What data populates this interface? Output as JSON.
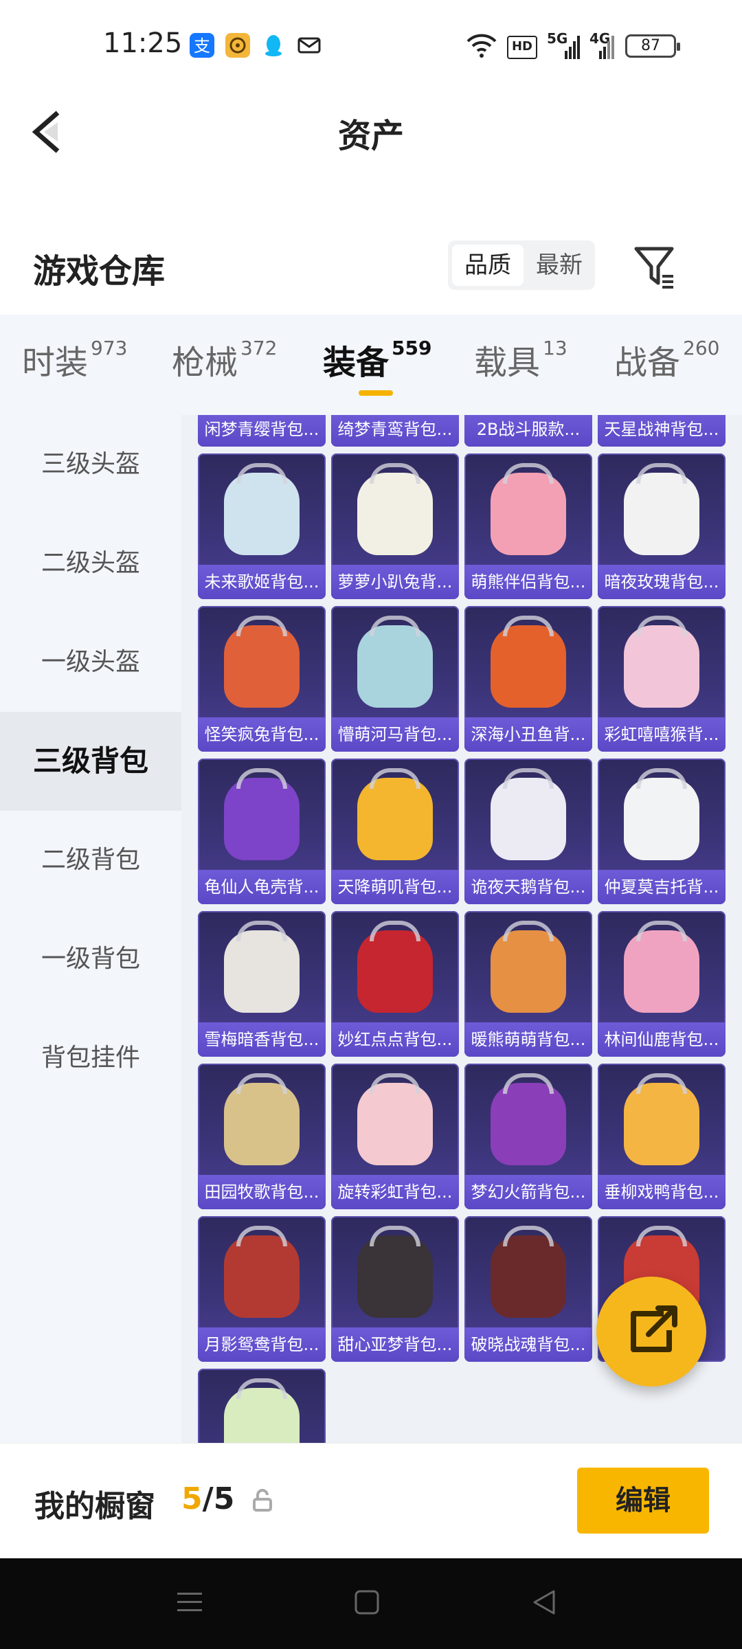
{
  "status_bar": {
    "time": "11:25",
    "network_label": "HD",
    "signal1": "5G",
    "signal2": "4G",
    "battery": "87",
    "notification_icons": [
      "alipay-icon",
      "wallet-app-icon",
      "qq-icon",
      "mail-icon"
    ],
    "right_icons": [
      "wifi-icon",
      "hd-icon",
      "signal-5g-icon",
      "signal-4g-icon",
      "battery-icon"
    ]
  },
  "header": {
    "title": "资产",
    "back_icon": "back-arrow-icon"
  },
  "section": {
    "title": "游戏仓库",
    "sort_options": [
      "品质",
      "最新"
    ],
    "sort_selected": "品质",
    "filter_icon": "filter-icon"
  },
  "tabs": [
    {
      "label": "时装",
      "count": "973"
    },
    {
      "label": "枪械",
      "count": "372"
    },
    {
      "label": "装备",
      "count": "559"
    },
    {
      "label": "载具",
      "count": "13"
    },
    {
      "label": "战备",
      "count": "260"
    }
  ],
  "active_tab": "装备",
  "sidebar": {
    "items": [
      "三级头盔",
      "二级头盔",
      "一级头盔",
      "三级背包",
      "二级背包",
      "一级背包",
      "背包挂件"
    ],
    "active": "三级背包"
  },
  "items": [
    {
      "name": "闲梦青缨背包...",
      "color": "#cfd2e0"
    },
    {
      "name": "绮梦青鸾背包...",
      "color": "#c9a15a"
    },
    {
      "name": "2B战斗服款...",
      "color": "#2a2a2a"
    },
    {
      "name": "天星战神背包...",
      "color": "#222833"
    },
    {
      "name": "未来歌姬背包...",
      "color": "#cfe3ef"
    },
    {
      "name": "萝萝小趴兔背...",
      "color": "#f2f0e4"
    },
    {
      "name": "萌熊伴侣背包...",
      "color": "#f4a0b4"
    },
    {
      "name": "暗夜玫瑰背包...",
      "color": "#f2f2f2"
    },
    {
      "name": "怪笑疯兔背包...",
      "color": "#e0603a"
    },
    {
      "name": "懵萌河马背包...",
      "color": "#a9d3dd"
    },
    {
      "name": "深海小丑鱼背...",
      "color": "#e4612c"
    },
    {
      "name": "彩虹嘻嘻猴背...",
      "color": "#f2c6d8"
    },
    {
      "name": "龟仙人龟壳背...",
      "color": "#7d43c8"
    },
    {
      "name": "天降萌叽背包...",
      "color": "#f3b62e"
    },
    {
      "name": "诡夜天鹅背包...",
      "color": "#ecebf4"
    },
    {
      "name": "仲夏莫吉托背...",
      "color": "#f1f3f4"
    },
    {
      "name": "雪梅暗香背包...",
      "color": "#e7e3de"
    },
    {
      "name": "妙红点点背包...",
      "color": "#c5262f"
    },
    {
      "name": "暖熊萌萌背包...",
      "color": "#e69044"
    },
    {
      "name": "林间仙鹿背包...",
      "color": "#f0a3c0"
    },
    {
      "name": "田园牧歌背包...",
      "color": "#d8c28a"
    },
    {
      "name": "旋转彩虹背包...",
      "color": "#f4c9cf"
    },
    {
      "name": "梦幻火箭背包...",
      "color": "#8a3fb8"
    },
    {
      "name": "垂柳戏鸭背包...",
      "color": "#f5b542"
    },
    {
      "name": "月影鸳鸯背包...",
      "color": "#b23a32"
    },
    {
      "name": "甜心亚梦背包...",
      "color": "#3a3338"
    },
    {
      "name": "破晓战魂背包...",
      "color": "#6a2a2c"
    },
    {
      "name": "",
      "color": "#c93b35"
    },
    {
      "name": "",
      "color": "#d9ecc0"
    }
  ],
  "fab_icon": "share-external-icon",
  "showcase": {
    "label": "我的橱窗",
    "current": "5",
    "separator": "/",
    "total": "5",
    "lock_icon": "lock-icon",
    "edit_label": "编辑"
  },
  "nav_bar": {
    "icons": [
      "menu-icon",
      "home-square-icon",
      "back-triangle-icon"
    ]
  }
}
